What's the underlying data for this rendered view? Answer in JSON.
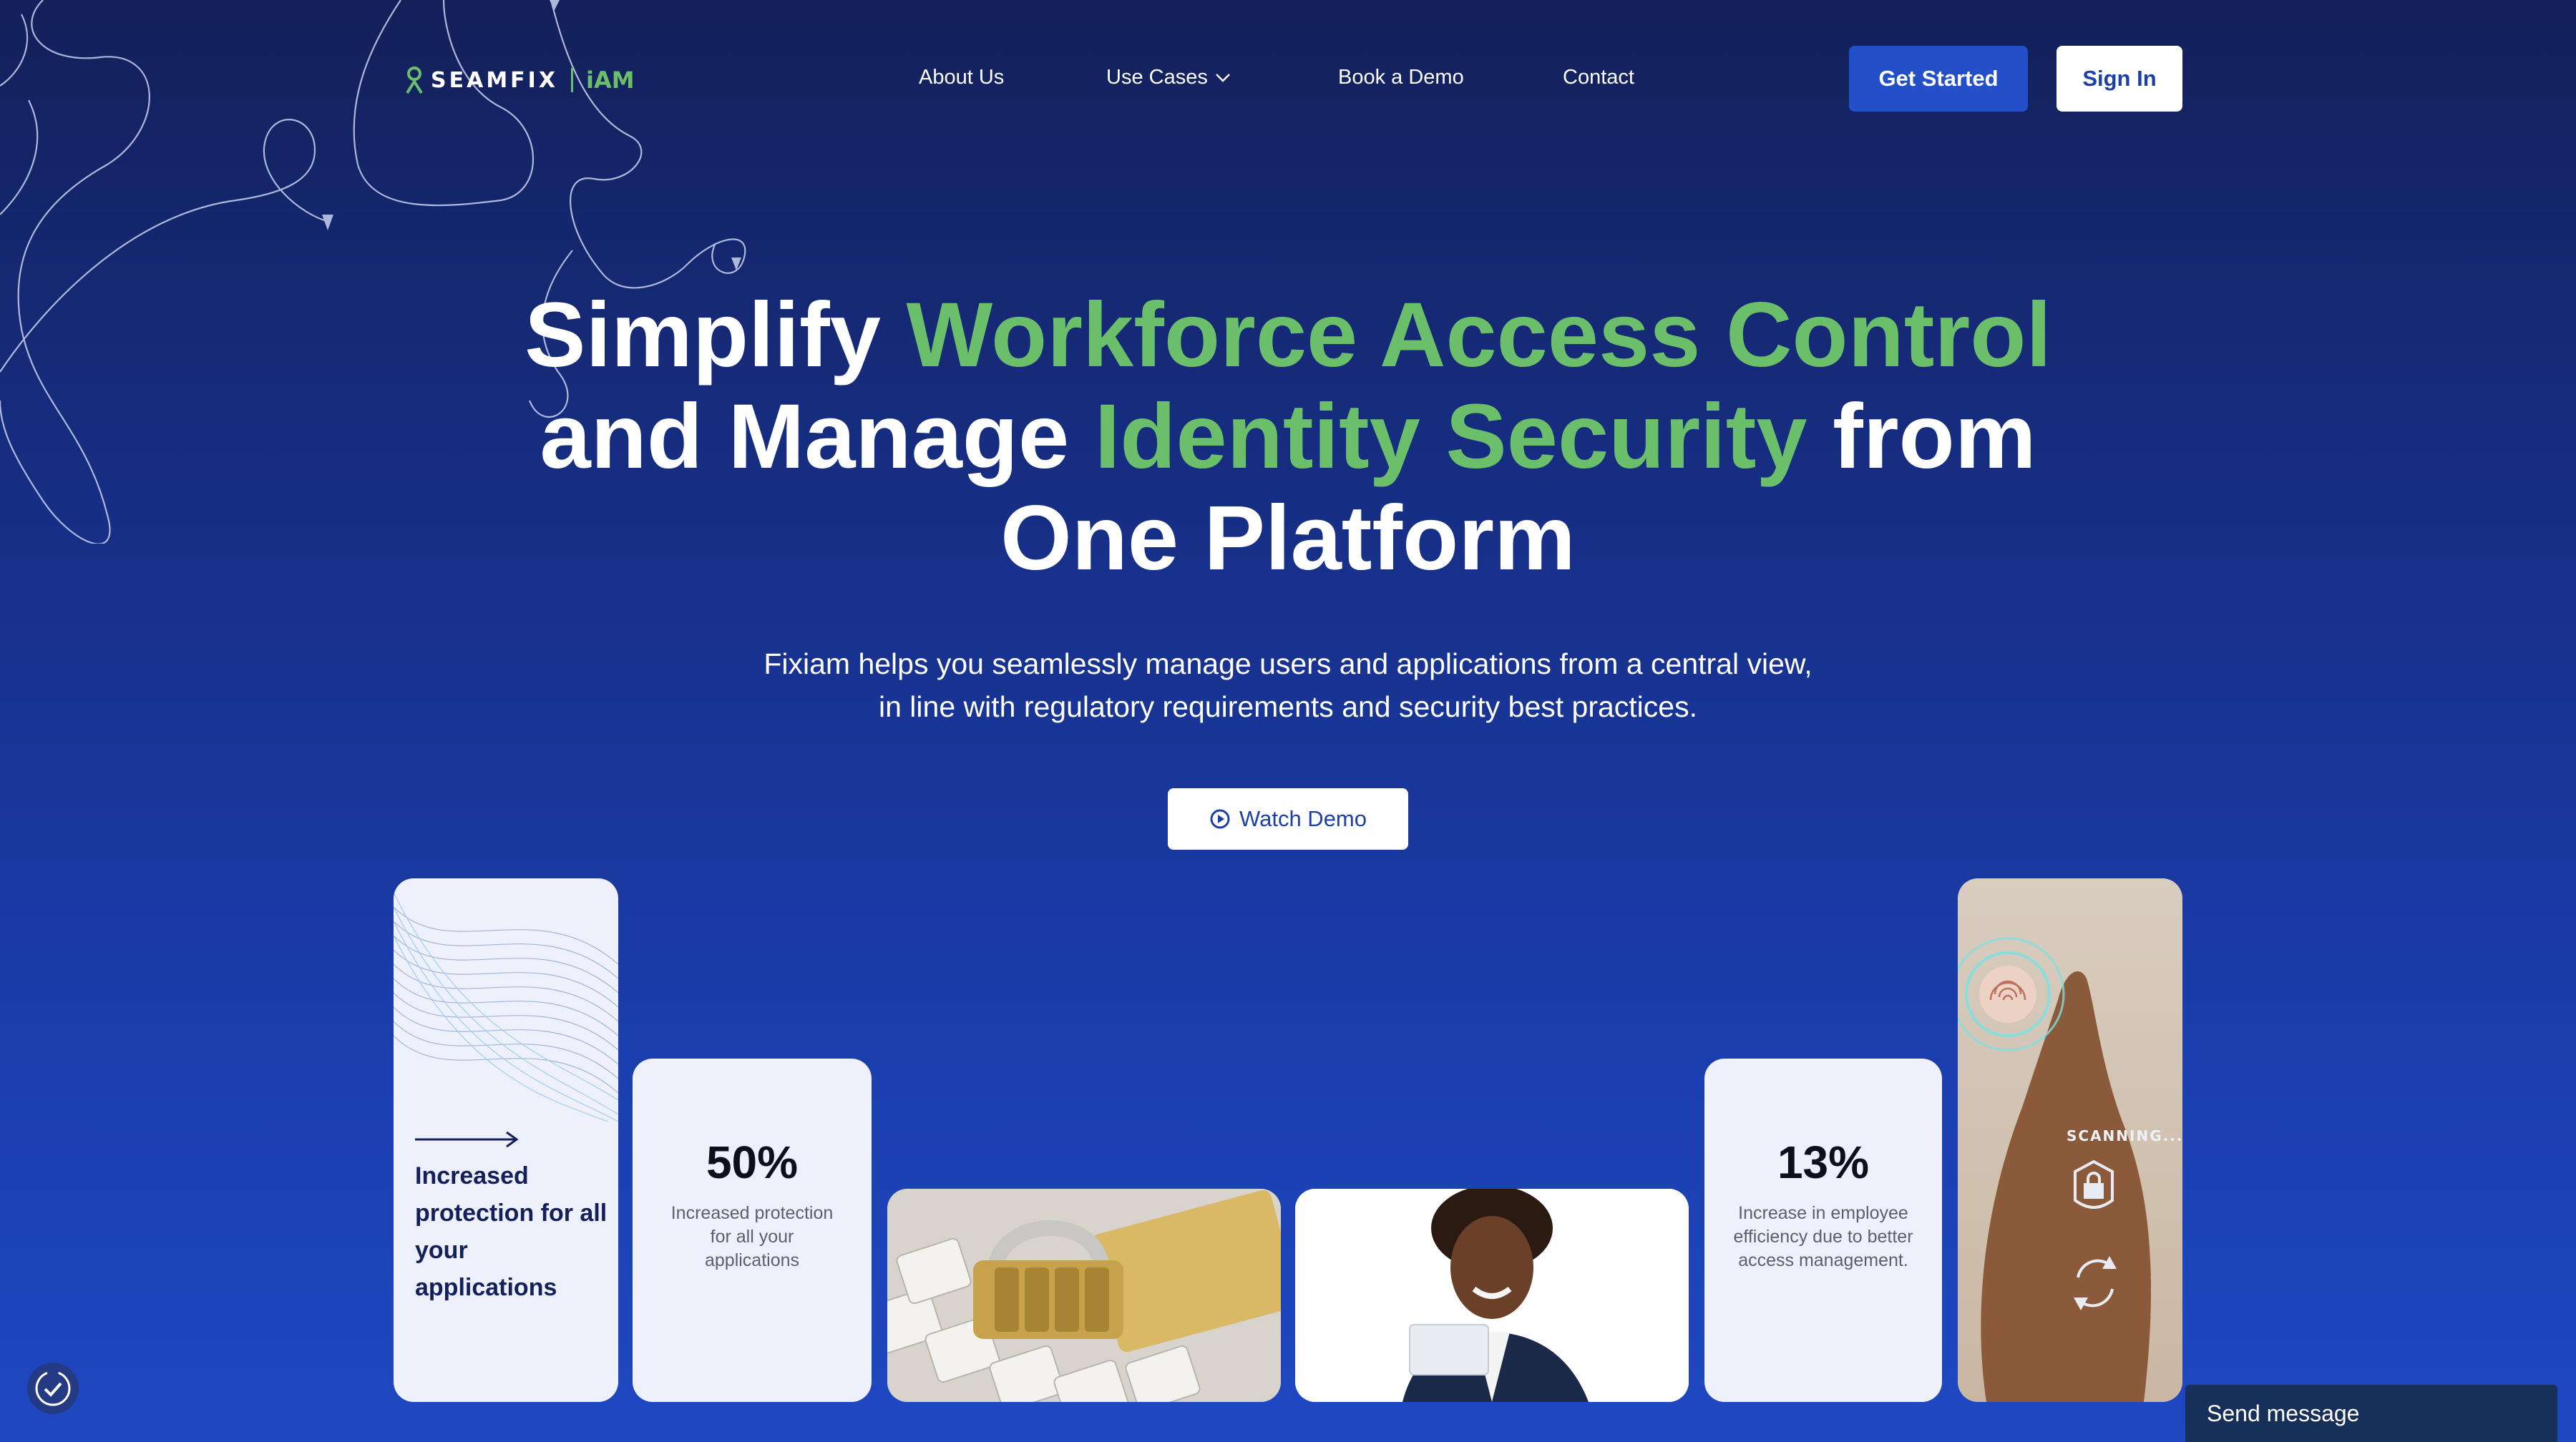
{
  "brand": {
    "name": "SEAMFIX",
    "product": "iAM",
    "accent": "#6bbf6a",
    "primary": "#2350c8"
  },
  "nav": {
    "links": [
      "About Us",
      "Use Cases",
      "Book a Demo",
      "Contact"
    ],
    "use_cases_icon": "chevron-down-icon",
    "get_started": "Get Started",
    "sign_in": "Sign In"
  },
  "hero": {
    "line1_a": "Simplify ",
    "line1_b": "Workforce Access Control",
    "line2_a": "and Manage ",
    "line2_b": "Identity Security",
    "line2_c": " from",
    "line3": "One Platform",
    "subtitle": "Fixiam helps you seamlessly manage users and applications from a central view, in line with regulatory requirements and security best practices.",
    "watch_demo": "Watch Demo",
    "watch_demo_icon": "play-circle-icon"
  },
  "cards": {
    "wave_text": "Increased protection for all your applications",
    "stat1": {
      "value": "50%",
      "desc": "Increased protection for all your applications"
    },
    "stat2": {
      "value": "13%",
      "desc": "Increase in employee efficiency due to better access management."
    },
    "finger_label": "SCANNING..."
  },
  "widgets": {
    "send_message": "Send message",
    "consent_icon": "cookie-consent-icon"
  }
}
